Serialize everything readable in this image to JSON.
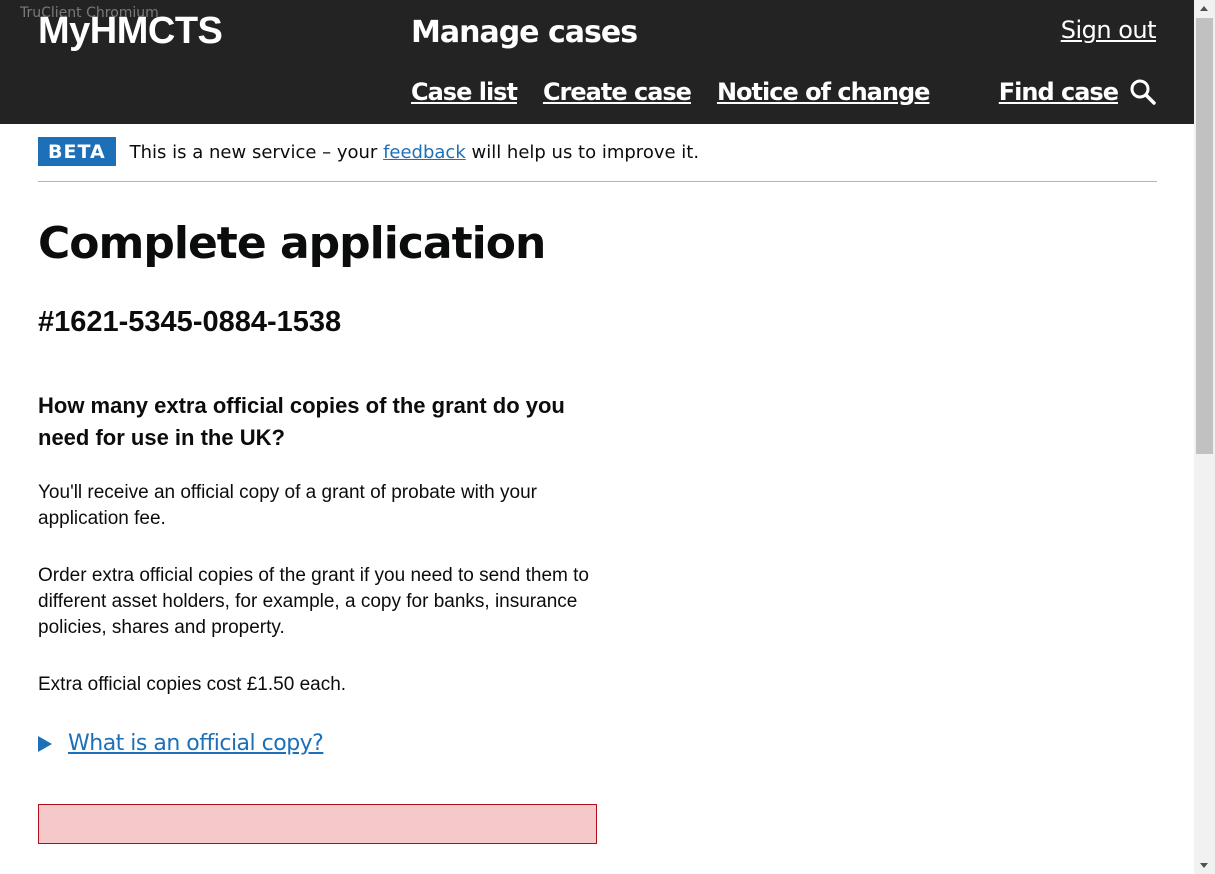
{
  "window": {
    "overlay_label": "TruClient Chromium"
  },
  "header": {
    "logo": "MyHMCTS",
    "service_name": "Manage cases",
    "sign_out": "Sign out",
    "nav": [
      {
        "label": "Case list"
      },
      {
        "label": "Create case"
      },
      {
        "label": "Notice of change"
      }
    ],
    "find_case": {
      "label": "Find case",
      "icon": "search-icon"
    }
  },
  "phase_banner": {
    "tag": "BETA",
    "text_before": "This is a new service – your ",
    "link": "feedback",
    "text_after": " will help us to improve it."
  },
  "main": {
    "title": "Complete application",
    "case_number": "#1621-5345-0884-1538",
    "question": "How many extra official copies of the grant do you need for use in the UK?",
    "paragraphs": [
      "You'll receive an official copy of a grant of probate with your application fee.",
      "Order extra official copies of the grant if you need to send them to different asset holders, for example, a copy for banks, insurance policies, shares and property.",
      "Extra official copies cost £1.50 each."
    ],
    "details_summary": "What is an official copy?"
  },
  "colors": {
    "header_bg": "#232323",
    "link": "#1d70b8",
    "tag_bg": "#1d70b8",
    "error_bg": "#f5c9c9",
    "error_border": "#b10e1e"
  }
}
